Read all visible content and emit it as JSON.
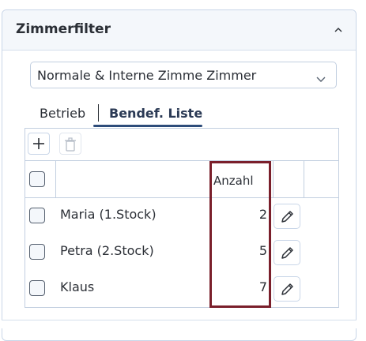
{
  "panel": {
    "title": "Zimmerfilter"
  },
  "select": {
    "value": "Normale & Interne Zimme Zimmer"
  },
  "tabs": [
    {
      "label": "Betrieb",
      "active": false
    },
    {
      "label": "Bendef. Liste",
      "active": true
    }
  ],
  "table": {
    "columns": {
      "count": "Anzahl"
    },
    "rows": [
      {
        "name": "Maria (1.Stock)",
        "count": "2"
      },
      {
        "name": "Petra (2.Stock)",
        "count": "5"
      },
      {
        "name": "Klaus",
        "count": "7"
      }
    ]
  },
  "icons": {
    "collapse": "chevron-up-icon",
    "dropdown": "chevron-down-icon",
    "add": "plus-icon",
    "delete": "trash-icon",
    "edit": "pencil-icon"
  },
  "colors": {
    "highlight": "#7a1f2b",
    "tab_underline": "#2d4c7a",
    "border": "#c2cfe0"
  }
}
